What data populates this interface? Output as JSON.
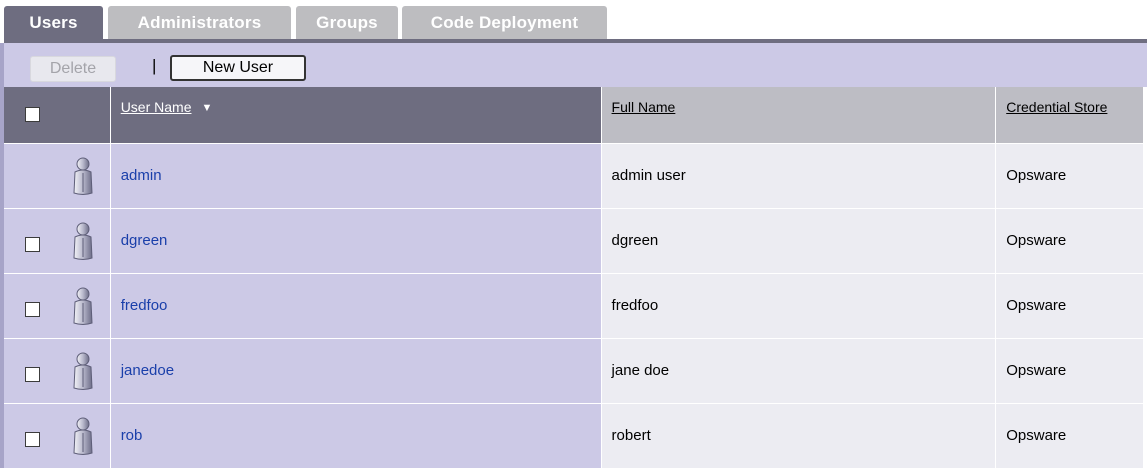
{
  "tabs": [
    {
      "label": "Users",
      "active": true
    },
    {
      "label": "Administrators",
      "active": false
    },
    {
      "label": "Groups",
      "active": false
    },
    {
      "label": "Code Deployment",
      "active": false
    }
  ],
  "toolbar": {
    "delete_label": "Delete",
    "separator": "|",
    "new_user_label": "New User"
  },
  "table": {
    "columns": {
      "user_name": "User Name",
      "full_name": "Full Name",
      "credential_store": "Credential Store"
    },
    "sort": {
      "column": "user_name",
      "icon": "sort-down-icon"
    },
    "rows": [
      {
        "user_name": "admin",
        "full_name": "admin user",
        "credential_store": "Opsware",
        "selectable": false,
        "icon": "user-icon"
      },
      {
        "user_name": "dgreen",
        "full_name": "dgreen",
        "credential_store": "Opsware",
        "selectable": true,
        "icon": "user-icon"
      },
      {
        "user_name": "fredfoo",
        "full_name": "fredfoo",
        "credential_store": "Opsware",
        "selectable": true,
        "icon": "user-icon"
      },
      {
        "user_name": "janedoe",
        "full_name": "jane doe",
        "credential_store": "Opsware",
        "selectable": true,
        "icon": "user-icon"
      },
      {
        "user_name": "rob",
        "full_name": "robert",
        "credential_store": "Opsware",
        "selectable": true,
        "icon": "user-icon"
      }
    ]
  },
  "colors": {
    "tab_active": "#6e6d80",
    "tab_inactive": "#bdbdc0",
    "toolbar_bg": "#ccc9e6",
    "header_dark": "#6e6d80",
    "header_light": "#bdbdc4",
    "row_left_bg": "#ccc9e6",
    "row_right_bg": "#ececf2",
    "link": "#1a3faa"
  }
}
